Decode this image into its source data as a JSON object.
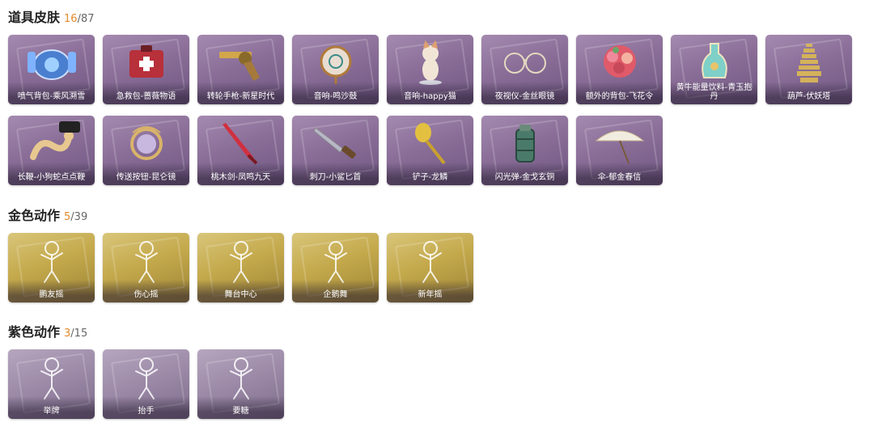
{
  "sections": [
    {
      "title": "道具皮肤",
      "owned": "16",
      "total": "/87",
      "theme": "purple",
      "items": [
        {
          "label": "喷气背包-乘风溯雪",
          "icon": "jetpack-icon"
        },
        {
          "label": "急救包-蔷薇物语",
          "icon": "medkit-icon"
        },
        {
          "label": "转轮手枪-新星时代",
          "icon": "revolver-icon"
        },
        {
          "label": "音响-鸣沙鼓",
          "icon": "drum-icon"
        },
        {
          "label": "音响-happy猫",
          "icon": "cat-icon"
        },
        {
          "label": "夜视仪-金丝眼镜",
          "icon": "glasses-icon"
        },
        {
          "label": "额外的背包-飞花令",
          "icon": "bouquet-icon"
        },
        {
          "label": "黄牛能量饮料-青玉抱丹",
          "icon": "bottle-icon"
        },
        {
          "label": "葫芦-伏妖塔",
          "icon": "pagoda-icon"
        },
        {
          "label": "长鞭-小狗蛇点点鞭",
          "icon": "snake-icon"
        },
        {
          "label": "传送按钮-昆仑镜",
          "icon": "mirror-icon"
        },
        {
          "label": "桃木剑-凤鸣九天",
          "icon": "sword-icon"
        },
        {
          "label": "刺刀-小鲨匕首",
          "icon": "dagger-icon"
        },
        {
          "label": "铲子-龙鳞",
          "icon": "shovel-icon"
        },
        {
          "label": "闪光弹-金戈玄铜",
          "icon": "grenade-icon"
        },
        {
          "label": "伞-郁金春信",
          "icon": "umbrella-icon"
        }
      ]
    },
    {
      "title": "金色动作",
      "owned": "5",
      "total": "/39",
      "theme": "gold",
      "items": [
        {
          "label": "鹏友摇",
          "icon": "pose-icon"
        },
        {
          "label": "伤心摇",
          "icon": "pose-icon"
        },
        {
          "label": "舞台中心",
          "icon": "pose-icon"
        },
        {
          "label": "企鹅舞",
          "icon": "pose-icon"
        },
        {
          "label": "新年摇",
          "icon": "pose-icon"
        }
      ]
    },
    {
      "title": "紫色动作",
      "owned": "3",
      "total": "/15",
      "theme": "gray",
      "items": [
        {
          "label": "举牌",
          "icon": "pose-icon"
        },
        {
          "label": "抬手",
          "icon": "pose-icon"
        },
        {
          "label": "要糖",
          "icon": "pose-icon"
        }
      ]
    }
  ]
}
